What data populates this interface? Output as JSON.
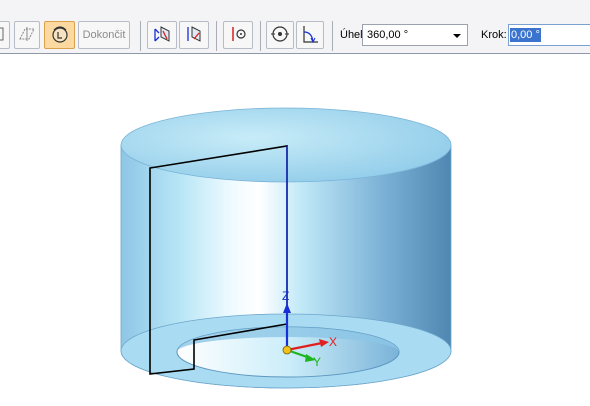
{
  "toolbar": {
    "finish_label": "Dokončit",
    "angle_label": "Úhel:",
    "angle_value": "360,00 °",
    "step_label": "Krok:",
    "step_value": "0,00 °"
  },
  "viewport": {
    "axis_z": "Z",
    "axis_x": "X",
    "axis_y": "Y"
  },
  "colors": {
    "part_fill": "#a8dcf2",
    "part_shade": "#5f97bd",
    "axis_z": "#1730d6",
    "axis_x": "#e02020",
    "axis_y": "#1eb51e",
    "active_button": "#fcd9a0"
  },
  "icons": [
    "sketch-view-icon",
    "tangent-plane-icon",
    "sweep-profile-icon",
    "axis-flip-icon",
    "axis-rotate-icon",
    "axis-point-icon",
    "circle-center-icon",
    "angle-rotate-icon"
  ]
}
